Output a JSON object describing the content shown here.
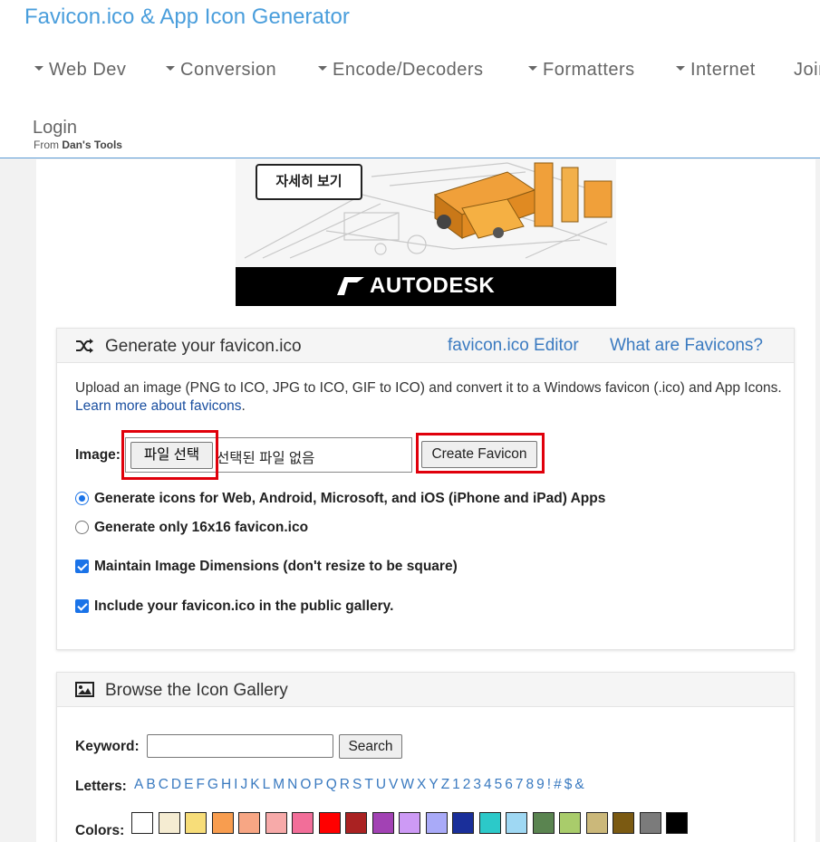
{
  "header": {
    "site_title": "Favicon.ico & App Icon Generator",
    "nav": [
      "Web Dev",
      "Conversion",
      "Encode/Decoders",
      "Formatters",
      "Internet",
      "Join"
    ],
    "login": "Login",
    "from_prefix": "From",
    "from_brand": "Dan's Tools"
  },
  "ad": {
    "cta": "자세히 보기",
    "brand": "AUTODESK"
  },
  "generate_panel": {
    "title": "Generate your favicon.ico",
    "links": [
      "favicon.ico Editor",
      "What are Favicons?"
    ],
    "description": "Upload an image (PNG to ICO, JPG to ICO, GIF to ICO) and convert it to a Windows favicon (.ico) and App Icons.",
    "learn_more": "Learn more about favicons",
    "image_label": "Image:",
    "file_button": "파일 선택",
    "file_status": "선택된 파일 없음",
    "create_button": "Create Favicon",
    "options": [
      {
        "type": "radio",
        "checked": true,
        "label": "Generate icons for Web, Android, Microsoft, and iOS (iPhone and iPad) Apps"
      },
      {
        "type": "radio",
        "checked": false,
        "label": "Generate only 16x16 favicon.ico"
      },
      {
        "type": "checkbox",
        "checked": true,
        "label": "Maintain Image Dimensions (don't resize to be square)"
      },
      {
        "type": "checkbox",
        "checked": true,
        "label": "Include your favicon.ico in the public gallery."
      }
    ]
  },
  "gallery_panel": {
    "title": "Browse the Icon Gallery",
    "keyword_label": "Keyword:",
    "keyword_value": "",
    "search_button": "Search",
    "letters_label": "Letters:",
    "letters": [
      "A",
      "B",
      "C",
      "D",
      "E",
      "F",
      "G",
      "H",
      "I",
      "J",
      "K",
      "L",
      "M",
      "N",
      "O",
      "P",
      "Q",
      "R",
      "S",
      "T",
      "U",
      "V",
      "W",
      "X",
      "Y",
      "Z",
      "1",
      "2",
      "3",
      "4",
      "5",
      "6",
      "7",
      "8",
      "9",
      "!",
      "#",
      "$",
      "&"
    ],
    "colors_label": "Colors:",
    "colors": [
      "#ffffff",
      "#f5ecd2",
      "#f7dd79",
      "#f89d4f",
      "#f7a684",
      "#f7aaa9",
      "#f26e99",
      "#ff0000",
      "#aa2222",
      "#a242b4",
      "#cd9af5",
      "#a9aaf8",
      "#1a2f9a",
      "#2cc9c9",
      "#9fd8f3",
      "#5a8450",
      "#a9cc6b",
      "#cbb87a",
      "#7b5a12",
      "#7b7b7b",
      "#000000"
    ]
  },
  "colors": {
    "title_blue": "#4a9edc",
    "link_blue": "#3a7ac0",
    "highlight_red": "#e0000b"
  }
}
